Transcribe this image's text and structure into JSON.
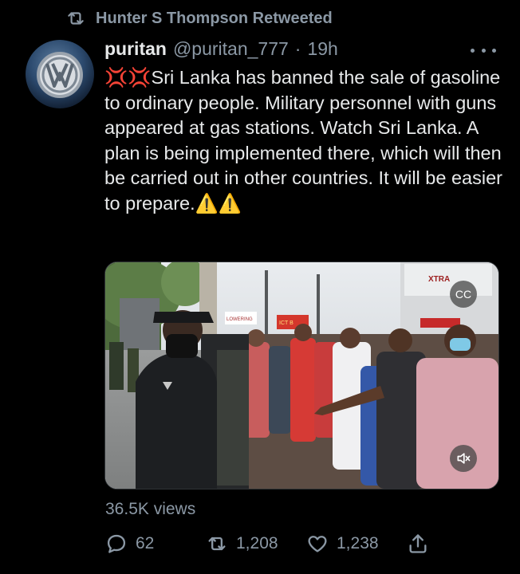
{
  "retweet_banner": {
    "text": "Hunter S Thompson Retweeted",
    "icon": "retweet-icon"
  },
  "author": {
    "name": "puritan",
    "handle": "@puritan_777",
    "separator": "·",
    "time": "19h"
  },
  "tweet": {
    "text": "Sri Lanka has banned the sale of gasoline to ordinary people. Military personnel with guns appeared at gas stations. Watch Sri Lanka. A plan is being implemented there, which will then be carried out in other countries. It will be easier to prepare.",
    "leading_emoji": "💢💢",
    "trailing_emoji": "⚠️⚠️"
  },
  "media": {
    "type": "video",
    "store_sign": "XTRA",
    "banner_left": "LOWERING",
    "banner_right": "ICT B",
    "cc_label": "CC"
  },
  "views": "36.5K views",
  "actions": {
    "replies": "62",
    "retweets": "1,208",
    "likes": "1,238"
  },
  "colors": {
    "background": "#000000",
    "text": "#e7e9ea",
    "muted": "#8b98a5",
    "border": "#2f3336"
  }
}
